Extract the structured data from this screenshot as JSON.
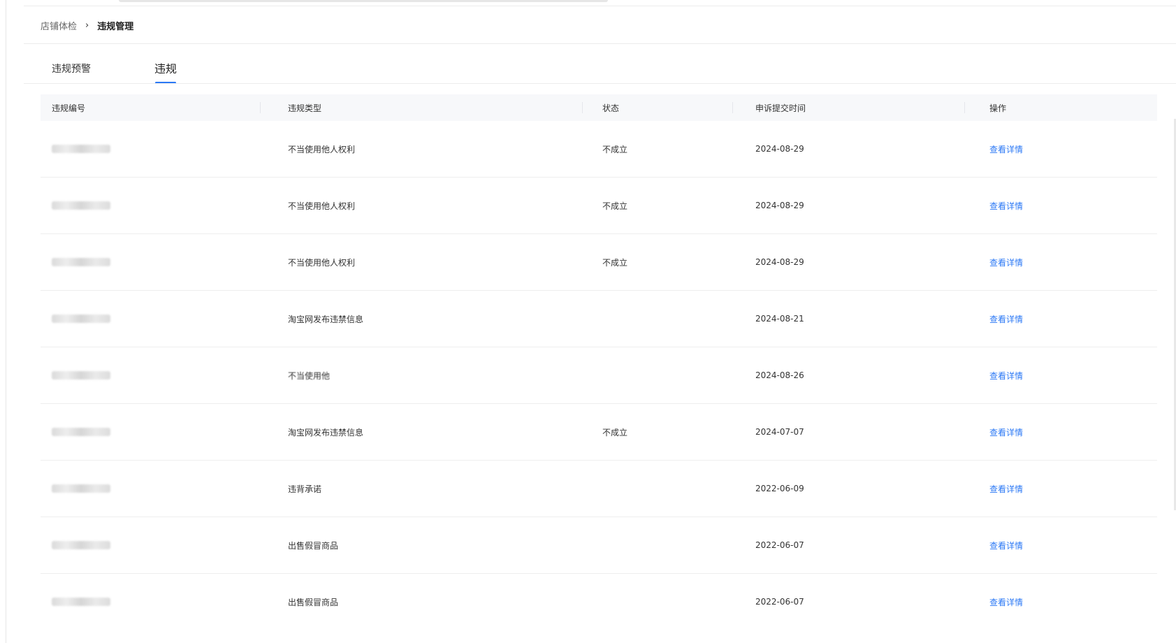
{
  "breadcrumb": {
    "parent": "店铺体检",
    "separator": "›",
    "current": "违规管理"
  },
  "tabs": [
    {
      "label": "违规预警",
      "active": false
    },
    {
      "label": "违规",
      "active": true
    }
  ],
  "table": {
    "headers": [
      "违规编号",
      "违规类型",
      "状态",
      "申诉提交时间",
      "操作"
    ],
    "rows": [
      {
        "type": "不当使用他人权利",
        "status": "不成立",
        "date": "2024-08-29",
        "action": "查看详情"
      },
      {
        "type": "不当使用他人权利",
        "status": "不成立",
        "date": "2024-08-29",
        "action": "查看详情"
      },
      {
        "type": "不当使用他人权利",
        "status": "不成立",
        "date": "2024-08-29",
        "action": "查看详情"
      },
      {
        "type": "淘宝网发布违禁信息",
        "status": "",
        "date": "2024-08-21",
        "action": "查看详情"
      },
      {
        "type": "不当使用他",
        "status": "",
        "date": "2024-08-26",
        "action": "查看详情"
      },
      {
        "type": "淘宝网发布违禁信息",
        "status": "不成立",
        "date": "2024-07-07",
        "action": "查看详情"
      },
      {
        "type": "违背承诺",
        "status": "",
        "date": "2022-06-09",
        "action": "查看详情"
      },
      {
        "type": "出售假冒商品",
        "status": "",
        "date": "2022-06-07",
        "action": "查看详情"
      },
      {
        "type": "出售假冒商品",
        "status": "",
        "date": "2022-06-07",
        "action": "查看详情"
      }
    ]
  },
  "colors": {
    "accent": "#2b78f5",
    "header_bg": "#f7f8fa"
  }
}
